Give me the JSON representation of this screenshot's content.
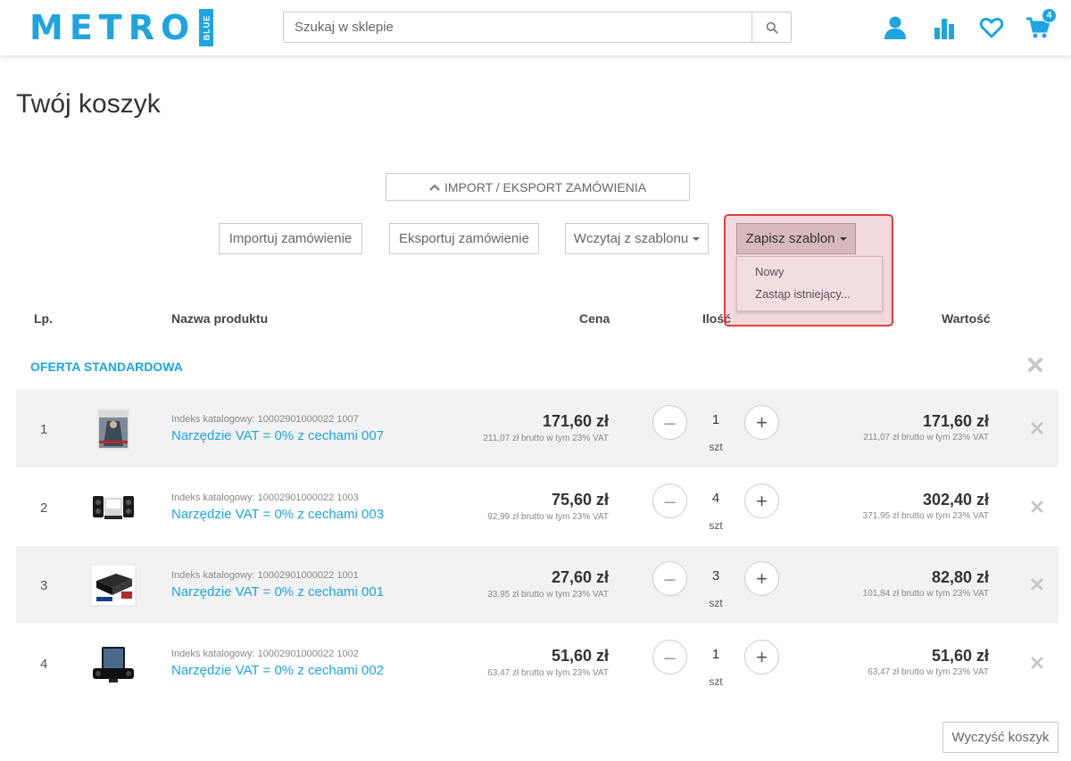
{
  "header": {
    "logo_text": "METRO",
    "logo_badge": "BLUE",
    "search_placeholder": "Szukaj w sklepie",
    "cart_count": "4",
    "icons": [
      "user-icon",
      "stats-icon",
      "heart-icon",
      "cart-icon",
      "search-icon"
    ]
  },
  "page_title": "Twój koszyk",
  "import_export": {
    "toggle_label": "IMPORT / EKSPORT ZAMÓWIENIA",
    "import_label": "Importuj zamówienie",
    "export_label": "Eksportuj zamówienie",
    "load_template_label": "Wczytaj z szablonu",
    "save_template_label": "Zapisz szablon",
    "save_template_menu": [
      "Nowy",
      "Zastąp istniejący..."
    ]
  },
  "table": {
    "headers": {
      "lp": "Lp.",
      "name": "Nazwa produktu",
      "price": "Cena",
      "qty": "Ilość",
      "value": "Wartość"
    },
    "section_title": "OFERTA STANDARDOWA",
    "rows": [
      {
        "lp": "1",
        "index": "Indeks katalogowy: 10002901000022 1007",
        "name": "Narzędzie VAT = 0% z cechami 007",
        "price": "171,60 zł",
        "price_brutto": "211,07 zł brutto w tym 23% VAT",
        "qty": "1",
        "unit": "szt",
        "value": "171,60 zł",
        "value_brutto": "211,07 zł brutto w tym 23% VAT"
      },
      {
        "lp": "2",
        "index": "Indeks katalogowy: 10002901000022 1003",
        "name": "Narzędzie VAT = 0% z cechami 003",
        "price": "75,60 zł",
        "price_brutto": "92,99 zł brutto w tym 23% VAT",
        "qty": "4",
        "unit": "szt",
        "value": "302,40 zł",
        "value_brutto": "371,95 zł brutto w tym 23% VAT"
      },
      {
        "lp": "3",
        "index": "Indeks katalogowy: 10002901000022 1001",
        "name": "Narzędzie VAT = 0% z cechami 001",
        "price": "27,60 zł",
        "price_brutto": "33,95 zł brutto w tym 23% VAT",
        "qty": "3",
        "unit": "szt",
        "value": "82,80 zł",
        "value_brutto": "101,84 zł brutto w tym 23% VAT"
      },
      {
        "lp": "4",
        "index": "Indeks katalogowy: 10002901000022 1002",
        "name": "Narzędzie VAT = 0% z cechami 002",
        "price": "51,60 zł",
        "price_brutto": "63,47 zł brutto w tym 23% VAT",
        "qty": "1",
        "unit": "szt",
        "value": "51,60 zł",
        "value_brutto": "63,47 zł brutto w tym 23% VAT"
      }
    ]
  },
  "clear_cart_label": "Wyczyść koszyk",
  "colors": {
    "brand": "#1ea4df",
    "highlight_border": "#e03e3e"
  }
}
